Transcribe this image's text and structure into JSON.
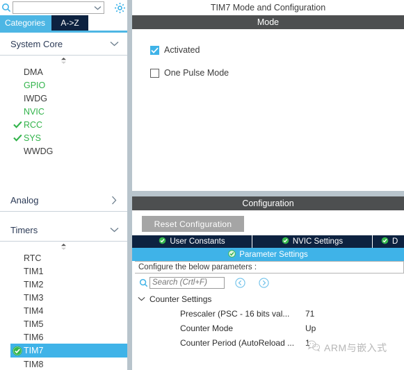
{
  "left_panel": {
    "search": {
      "value": "",
      "placeholder": ""
    },
    "gear_icon": "gear-icon",
    "search_icon": "search-icon",
    "dropdown_icon": "chevron-down-icon",
    "tabs": [
      {
        "label": "Categories",
        "active": true
      },
      {
        "label": "A->Z",
        "active": false
      }
    ],
    "groups": [
      {
        "title": "System Core",
        "expanded": true,
        "chevron": "chevron-down-icon",
        "items": [
          {
            "label": "DMA",
            "state": "plain",
            "checked": false
          },
          {
            "label": "GPIO",
            "state": "green",
            "checked": false
          },
          {
            "label": "IWDG",
            "state": "plain",
            "checked": false
          },
          {
            "label": "NVIC",
            "state": "green",
            "checked": false
          },
          {
            "label": "RCC",
            "state": "green",
            "checked": true
          },
          {
            "label": "SYS",
            "state": "green",
            "checked": true
          },
          {
            "label": "WWDG",
            "state": "plain",
            "checked": false
          }
        ]
      },
      {
        "title": "Analog",
        "expanded": false,
        "chevron": "chevron-right-icon",
        "items": []
      },
      {
        "title": "Timers",
        "expanded": true,
        "chevron": "chevron-down-icon",
        "items": [
          {
            "label": "RTC",
            "state": "plain",
            "checked": false
          },
          {
            "label": "TIM1",
            "state": "plain",
            "checked": false
          },
          {
            "label": "TIM2",
            "state": "plain",
            "checked": false
          },
          {
            "label": "TIM3",
            "state": "plain",
            "checked": false
          },
          {
            "label": "TIM4",
            "state": "plain",
            "checked": false
          },
          {
            "label": "TIM5",
            "state": "plain",
            "checked": false
          },
          {
            "label": "TIM6",
            "state": "plain",
            "checked": false
          },
          {
            "label": "TIM7",
            "state": "selected",
            "checked": true
          },
          {
            "label": "TIM8",
            "state": "plain",
            "checked": false
          }
        ]
      }
    ]
  },
  "right_panel": {
    "title": "TIM7 Mode and Configuration",
    "mode_section": {
      "header": "Mode",
      "checkboxes": [
        {
          "label": "Activated",
          "checked": true
        },
        {
          "label": "One Pulse Mode",
          "checked": false
        }
      ]
    },
    "configuration_section": {
      "header": "Configuration",
      "reset_button": "Reset Configuration",
      "tabs_top": [
        {
          "label": "User Constants",
          "icon": "check-circle-icon"
        },
        {
          "label": "NVIC Settings",
          "icon": "check-circle-icon"
        },
        {
          "label": "D",
          "icon": "check-circle-icon"
        }
      ],
      "tab_active": {
        "label": "Parameter Settings",
        "icon": "check-circle-icon"
      },
      "configure_hint": "Configure the below parameters :",
      "param_search": {
        "placeholder": "Search (Crtl+F)",
        "value": "",
        "icon": "search-icon",
        "prev_icon": "chevron-left-circle-icon",
        "next_icon": "chevron-right-circle-icon"
      },
      "param_tree": {
        "group_label": "Counter Settings",
        "group_chevron": "chevron-down-icon",
        "rows": [
          {
            "name": "Prescaler (PSC - 16 bits val...",
            "value": "71"
          },
          {
            "name": "Counter Mode",
            "value": "Up"
          },
          {
            "name": "Counter Period (AutoReload ...",
            "value": "1"
          }
        ]
      }
    }
  },
  "watermark": {
    "text": "ARM与嵌入式",
    "icon": "wechat-logo-icon"
  },
  "colors": {
    "accent_blue": "#3fb3e8",
    "dark_navy": "#0d2240",
    "dark_header": "#4d4f50",
    "splitter": "#b8c4cc",
    "green": "#31b34a",
    "button_grey": "#a5a5a5"
  }
}
